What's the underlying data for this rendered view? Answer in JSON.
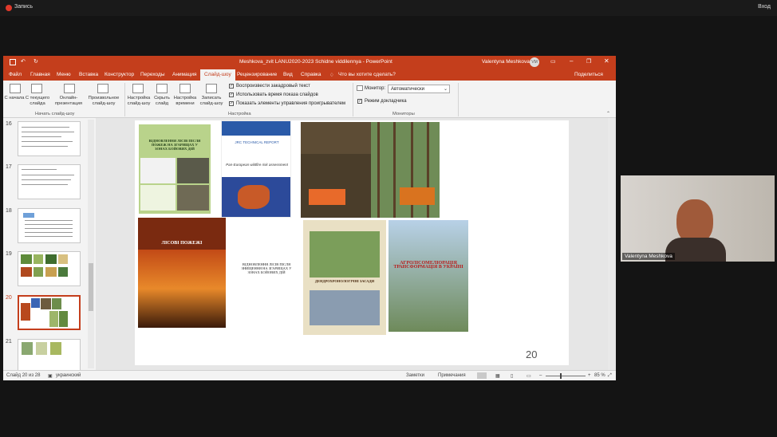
{
  "zoom": {
    "recording_label": "Запись",
    "exit_label": "Вход"
  },
  "window": {
    "title": "Meshkova_zvit LANU2020-2023 Schidne viddilennya - PowerPoint",
    "user": "Valentyna Meshkova",
    "user_initials": "VM"
  },
  "menu": {
    "items": [
      "Файл",
      "Главная",
      "Меню",
      "Вставка",
      "Конструктор",
      "Переходы",
      "Анимация",
      "Слайд-шоу",
      "Рецензирование",
      "Вид",
      "Справка"
    ],
    "active": "Слайд-шоу",
    "tell_me": "Что вы хотите сделать?",
    "share": "Поделиться"
  },
  "ribbon": {
    "start_group": {
      "buttons": [
        "С начала",
        "С текущего слайда",
        "Онлайн-презентация",
        "Произвольное слайд-шоу"
      ],
      "label": "Начать слайд-шоу"
    },
    "setup_group": {
      "buttons": [
        "Настройка слайд-шоу",
        "Скрыть слайд",
        "Настройка времени",
        "Записать слайд-шоу"
      ],
      "checks": [
        {
          "label": "Воспроизвести закадровый текст",
          "checked": true
        },
        {
          "label": "Использовать время показа слайдов",
          "checked": true
        },
        {
          "label": "Показать элементы управления проигрывателем",
          "checked": true
        }
      ],
      "label": "Настройка"
    },
    "monitors_group": {
      "monitor_label": "Монитор:",
      "monitor_value": "Автоматически",
      "presenter_view": "Режим докладчика",
      "label": "Мониторы"
    }
  },
  "thumbnails": {
    "numbers": [
      "16",
      "17",
      "18",
      "19",
      "20",
      "21"
    ],
    "selected": "20"
  },
  "slide": {
    "number": "20",
    "covers": {
      "c1_title": "ВІДНОВЛЕННЯ ЛІСІВ ПІСЛЯ ПОЖЕЖ НА ЗГАРИЩАХ У ЗОНАХ БОЙОВИХ ДІЙ",
      "c2_title": "JRC TECHNICAL REPORT",
      "c2_sub": "Pan-European wildfire risk assessment",
      "c3_title": "ВІДНОВЛЕННЯ ЛІСІВ ПІСЛЯ ЗНИЩЕННЯ НА ЗГАРИЩАХ У ЗОНАХ БОЙОВИХ ДІЙ",
      "c4_title": "ДЕНДРОХРОНОЛОГІЧНІ ЗАСАДИ",
      "c5_title": "АГРОЛІСОМЕЛІОРАЦІЯ ТРАНСФОРМАЦІЯ В УКРАЇНІ",
      "c6_title": "ЛІСОВІ ПОЖЕЖІ",
      "c7_title": "ЛІСОВІ ПОЖЕЖІ"
    }
  },
  "status": {
    "slide_counter": "Слайд 20 из 28",
    "language": "украинский",
    "notes": "Заметки",
    "comments": "Примечания",
    "zoom": "85 %"
  },
  "webcam": {
    "name": "Valentyna Meshkova"
  },
  "colors": {
    "accent": "#c43e1c"
  }
}
